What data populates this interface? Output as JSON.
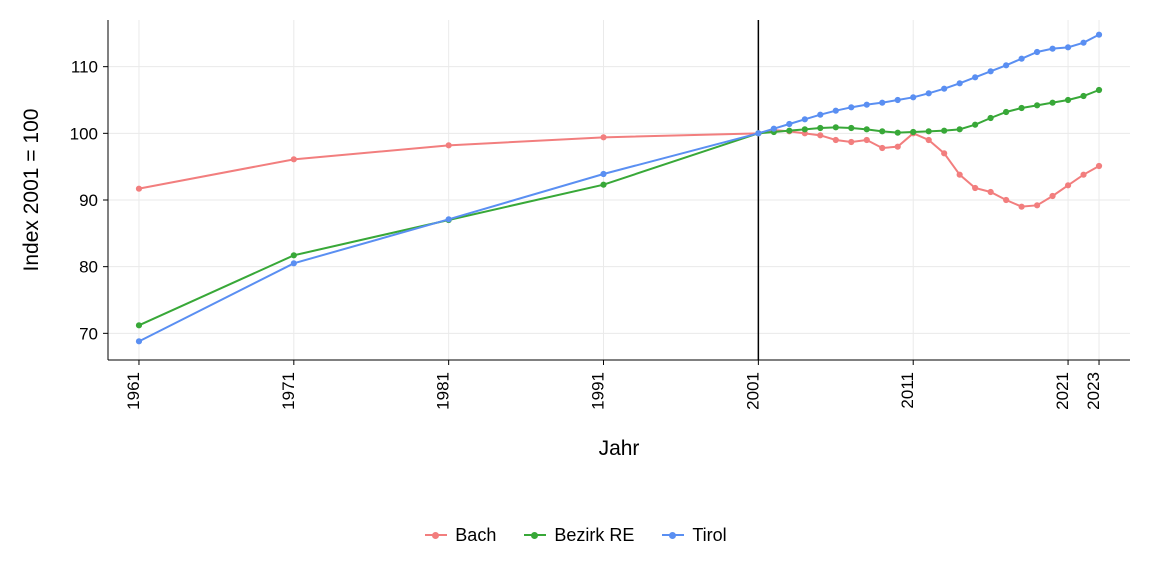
{
  "chart_data": {
    "type": "line",
    "xlabel": "Jahr",
    "ylabel": "Index 2001 = 100",
    "xlim": [
      1959,
      2025
    ],
    "ylim": [
      66,
      117
    ],
    "x_ticks": [
      1961,
      1971,
      1981,
      1991,
      2001,
      2011,
      2021,
      2023
    ],
    "y_ticks": [
      70,
      80,
      90,
      100,
      110
    ],
    "reference_line_x": 2001,
    "colors": {
      "Bach": "#f27e7e",
      "Bezirk RE": "#38a838",
      "Tirol": "#5a8ff2"
    },
    "series": [
      {
        "name": "Bach",
        "x": [
          1961,
          1971,
          1981,
          1991,
          2001,
          2002,
          2003,
          2004,
          2005,
          2006,
          2007,
          2008,
          2009,
          2010,
          2011,
          2012,
          2013,
          2014,
          2015,
          2016,
          2017,
          2018,
          2019,
          2020,
          2021,
          2022,
          2023
        ],
        "values": [
          91.7,
          96.1,
          98.2,
          99.4,
          100.0,
          100.5,
          100.3,
          100.0,
          99.7,
          99.0,
          98.7,
          99.0,
          97.8,
          98.0,
          100.0,
          99.0,
          97.0,
          93.8,
          91.8,
          91.2,
          90.0,
          89.0,
          89.2,
          90.6,
          92.2,
          93.8,
          95.1
        ]
      },
      {
        "name": "Bezirk RE",
        "x": [
          1961,
          1971,
          1981,
          1991,
          2001,
          2002,
          2003,
          2004,
          2005,
          2006,
          2007,
          2008,
          2009,
          2010,
          2011,
          2012,
          2013,
          2014,
          2015,
          2016,
          2017,
          2018,
          2019,
          2020,
          2021,
          2022,
          2023
        ],
        "values": [
          71.2,
          81.7,
          87.0,
          92.3,
          100.0,
          100.2,
          100.4,
          100.6,
          100.8,
          100.9,
          100.8,
          100.6,
          100.3,
          100.1,
          100.2,
          100.3,
          100.4,
          100.6,
          101.3,
          102.3,
          103.2,
          103.8,
          104.2,
          104.6,
          105.0,
          105.6,
          106.5
        ]
      },
      {
        "name": "Tirol",
        "x": [
          1961,
          1971,
          1981,
          1991,
          2001,
          2002,
          2003,
          2004,
          2005,
          2006,
          2007,
          2008,
          2009,
          2010,
          2011,
          2012,
          2013,
          2014,
          2015,
          2016,
          2017,
          2018,
          2019,
          2020,
          2021,
          2022,
          2023
        ],
        "values": [
          68.8,
          80.5,
          87.1,
          93.9,
          100.0,
          100.7,
          101.4,
          102.1,
          102.8,
          103.4,
          103.9,
          104.3,
          104.6,
          105.0,
          105.4,
          106.0,
          106.7,
          107.5,
          108.4,
          109.3,
          110.2,
          111.2,
          112.2,
          112.7,
          112.9,
          113.6,
          114.8
        ]
      }
    ],
    "legend_position": "bottom"
  }
}
